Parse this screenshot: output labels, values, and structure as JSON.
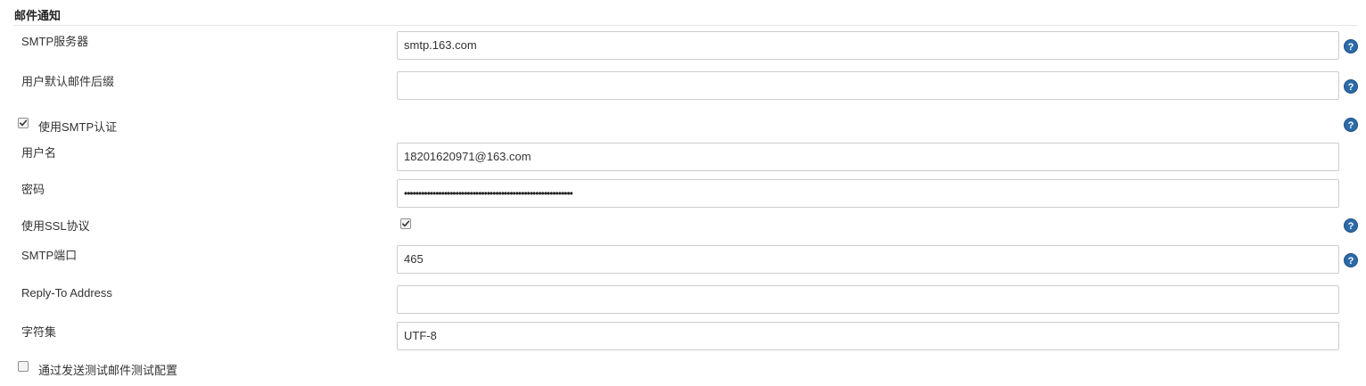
{
  "section": {
    "title": "邮件通知"
  },
  "fields": {
    "smtp_server": {
      "label": "SMTP服务器",
      "value": "smtp.163.com"
    },
    "default_suffix": {
      "label": "用户默认邮件后缀",
      "value": ""
    },
    "use_smtp_auth": {
      "label": "使用SMTP认证",
      "checked": true
    },
    "username": {
      "label": "用户名",
      "value": "18201620971@163.com"
    },
    "password": {
      "label": "密码",
      "value": "•••••••••••••••••••••••••••••••••••••••••••••••••••••••••••"
    },
    "use_ssl": {
      "label": "使用SSL协议",
      "checked": true
    },
    "smtp_port": {
      "label": "SMTP端口",
      "value": "465"
    },
    "reply_to": {
      "label": "Reply-To Address",
      "value": ""
    },
    "charset": {
      "label": "字符集",
      "value": "UTF-8"
    },
    "test_config": {
      "label": "通过发送测试邮件测试配置",
      "checked": false
    }
  },
  "icons": {
    "help": "help-icon",
    "check": "checkmark-icon"
  },
  "colors": {
    "help_icon": "#2c6aa8",
    "input_border": "#cccccc",
    "divider": "#e5e5e5"
  }
}
